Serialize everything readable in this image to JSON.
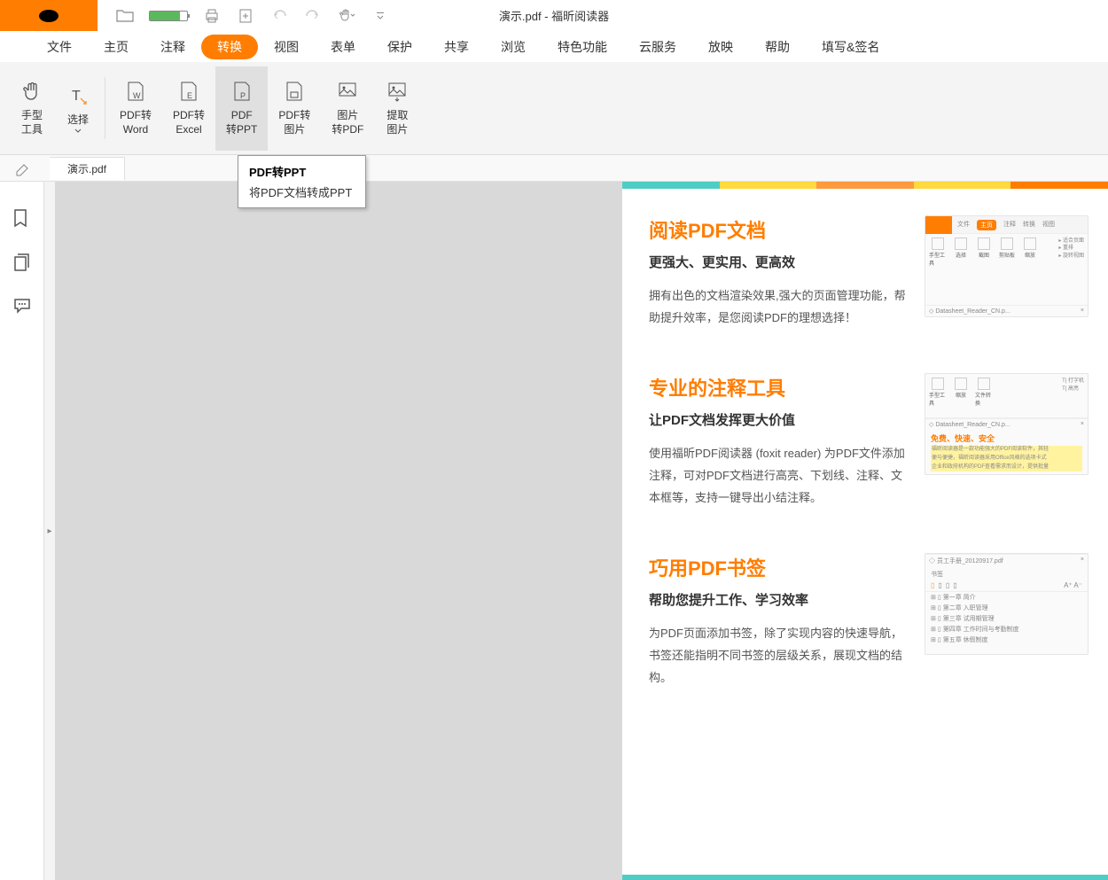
{
  "title": "演示.pdf - 福昕阅读器",
  "menu": [
    "文件",
    "主页",
    "注释",
    "转换",
    "视图",
    "表单",
    "保护",
    "共享",
    "浏览",
    "特色功能",
    "云服务",
    "放映",
    "帮助",
    "填写&签名"
  ],
  "menu_active_index": 3,
  "ribbon": [
    {
      "label": "手型\n工具"
    },
    {
      "label": "选择"
    },
    {
      "label": "PDF转\nWord"
    },
    {
      "label": "PDF转\nExcel"
    },
    {
      "label": "PDF\n转PPT"
    },
    {
      "label": "PDF转\n图片"
    },
    {
      "label": "图片\n转PDF"
    },
    {
      "label": "提取\n图片"
    }
  ],
  "ribbon_active_index": 4,
  "tooltip": {
    "title": "PDF转PPT",
    "desc": "将PDF文档转成PPT"
  },
  "tab_name": "演示.pdf",
  "features": [
    {
      "title": "阅读PDF文档",
      "sub": "更强大、更实用、更高效",
      "desc": "拥有出色的文档渲染效果,强大的页面管理功能，帮助提升效率，是您阅读PDF的理想选择！",
      "mini": {
        "type": "home",
        "tabs": [
          "文件",
          "主页",
          "注释",
          "转换",
          "视图"
        ],
        "file": "Datasheet_Reader_CN.p...",
        "btns": [
          "手型工具",
          "选择",
          "截图",
          "剪贴板",
          "缩放"
        ],
        "extras": [
          "适合页面",
          "重排",
          "旋转视图"
        ]
      }
    },
    {
      "title": "专业的注释工具",
      "sub": "让PDF文档发挥更大价值",
      "desc": "使用福昕PDF阅读器 (foxit reader) 为PDF文件添加注释，可对PDF文档进行高亮、下划线、注释、文本框等，支持一键导出小结注释。",
      "mini": {
        "type": "annotate",
        "file": "Datasheet_Reader_CN.p...",
        "highlight_title": "免费、快速、安全",
        "highlight_lines": [
          "福昕阅读器是一款功能强大的PDF阅读软件，其轻",
          "便与便捷，福昕阅读器采用Office风格的选项卡式",
          "企业和政府机构的PDF查看需求而设计，提供批量"
        ],
        "btns": [
          "手型工具",
          "缩放",
          "文件转换"
        ],
        "extras": [
          "打字机",
          "高亮"
        ]
      }
    },
    {
      "title": "巧用PDF书签",
      "sub": "帮助您提升工作、学习效率",
      "desc": "为PDF页面添加书签，除了实现内容的快速导航，书签还能指明不同书签的层级关系，展现文档的结构。",
      "mini": {
        "type": "bookmark",
        "file": "员工手册_20120917.pdf",
        "panel_title": "书签",
        "items": [
          "第一章  简介",
          "第二章  入职管理",
          "第三章  试用期管理",
          "第四章  工作时间与考勤制度",
          "第五章  休假制度"
        ]
      }
    }
  ],
  "stripe_colors": [
    "#4ecdc4",
    "#ffd93d",
    "#ff9a3d",
    "#ffd93d",
    "#ff7d00"
  ]
}
